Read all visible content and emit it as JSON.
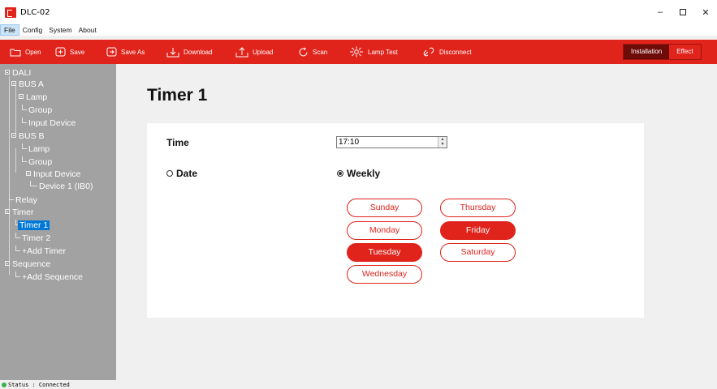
{
  "window": {
    "title": "DLC-02",
    "minimize": "–",
    "close": "✕"
  },
  "menu": [
    "File",
    "Config",
    "System",
    "About"
  ],
  "toolbar": {
    "open": "Open",
    "save": "Save",
    "save_as": "Save As",
    "download": "Download",
    "upload": "Upload",
    "scan": "Scan",
    "lamp_test": "Lamp Test",
    "disconnect": "Disconnect",
    "mode_tabs": [
      {
        "label": "Installation",
        "active": true
      },
      {
        "label": "Effect",
        "active": false
      }
    ]
  },
  "tree": {
    "dali": "DALI",
    "bus_a": "BUS A",
    "bus_a_lamp": "Lamp",
    "bus_a_group": "Group",
    "bus_a_input": "Input Device",
    "bus_b": "BUS B",
    "bus_b_lamp": "Lamp",
    "bus_b_group": "Group",
    "bus_b_input": "Input Device",
    "device_1": "Device 1 (IB0)",
    "relay": "Relay",
    "timer": "Timer",
    "timer_1": "Timer 1",
    "timer_2": "Timer 2",
    "add_timer": "+Add Timer",
    "sequence": "Sequence",
    "add_sequence": "+Add Sequence",
    "selected": "Timer 1"
  },
  "main": {
    "title": "Timer 1",
    "time_label": "Time",
    "time_value": "17:10",
    "date_label": "Date",
    "weekly_label": "Weekly",
    "mode_selected": "Weekly",
    "days": [
      {
        "label": "Sunday",
        "selected": false
      },
      {
        "label": "Monday",
        "selected": false
      },
      {
        "label": "Tuesday",
        "selected": true
      },
      {
        "label": "Wednesday",
        "selected": false
      },
      {
        "label": "Thursday",
        "selected": false
      },
      {
        "label": "Friday",
        "selected": true
      },
      {
        "label": "Saturday",
        "selected": false
      }
    ]
  },
  "status": {
    "text": "Status : Connected",
    "color": "#37b24d"
  },
  "colors": {
    "accent": "#e0231b",
    "sidebar": "#a2a2a2",
    "selection": "#0078d7"
  }
}
